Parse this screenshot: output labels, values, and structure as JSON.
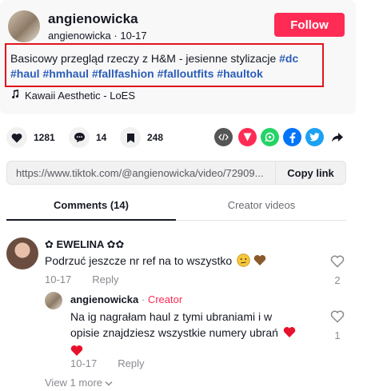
{
  "video": {
    "author": "angienowicka",
    "handle": "angienowicka",
    "date": "10-17",
    "follow_label": "Follow",
    "description_text": "Basicowy przegląd rzeczy z H&M - jesienne stylizacje ",
    "hashtags_line1": "#dc",
    "hashtags_line2": [
      "#haul",
      "#hmhaul",
      "#fallfashion",
      "#falloutfits",
      "#haultok"
    ],
    "music": "Kawaii Aesthetic - LoES"
  },
  "actions": {
    "likes": "1281",
    "comments": "14",
    "saves": "248"
  },
  "share_icons": [
    "embed-icon",
    "send-icon",
    "whatsapp-icon",
    "facebook-icon",
    "twitter-icon",
    "share-arrow-icon"
  ],
  "colors": {
    "accent": "#fe2c55",
    "hashtag": "#2b5db9",
    "highlight_border": "#e3141c"
  },
  "link": {
    "url": "https://www.tiktok.com/@angienowicka/video/72909...",
    "copy_label": "Copy link"
  },
  "tabs": {
    "comments": "Comments (14)",
    "creator_videos": "Creator videos"
  },
  "comments": [
    {
      "name": "✿ EWELINA ✿✿",
      "text": "Podrzuć jeszcze nr ref na to wszystko",
      "date": "10-17",
      "reply_label": "Reply",
      "likes": "2",
      "replies": [
        {
          "name": "angienowicka",
          "separator": " · ",
          "badge": "Creator",
          "text_line1": "Na ig nagrałam haul z tymi ubraniami i w",
          "text_line2": "opisie znajdziesz wszystkie numery ubrań",
          "date": "10-17",
          "reply_label": "Reply",
          "likes": "1"
        }
      ],
      "view_more": "View 1 more"
    }
  ]
}
